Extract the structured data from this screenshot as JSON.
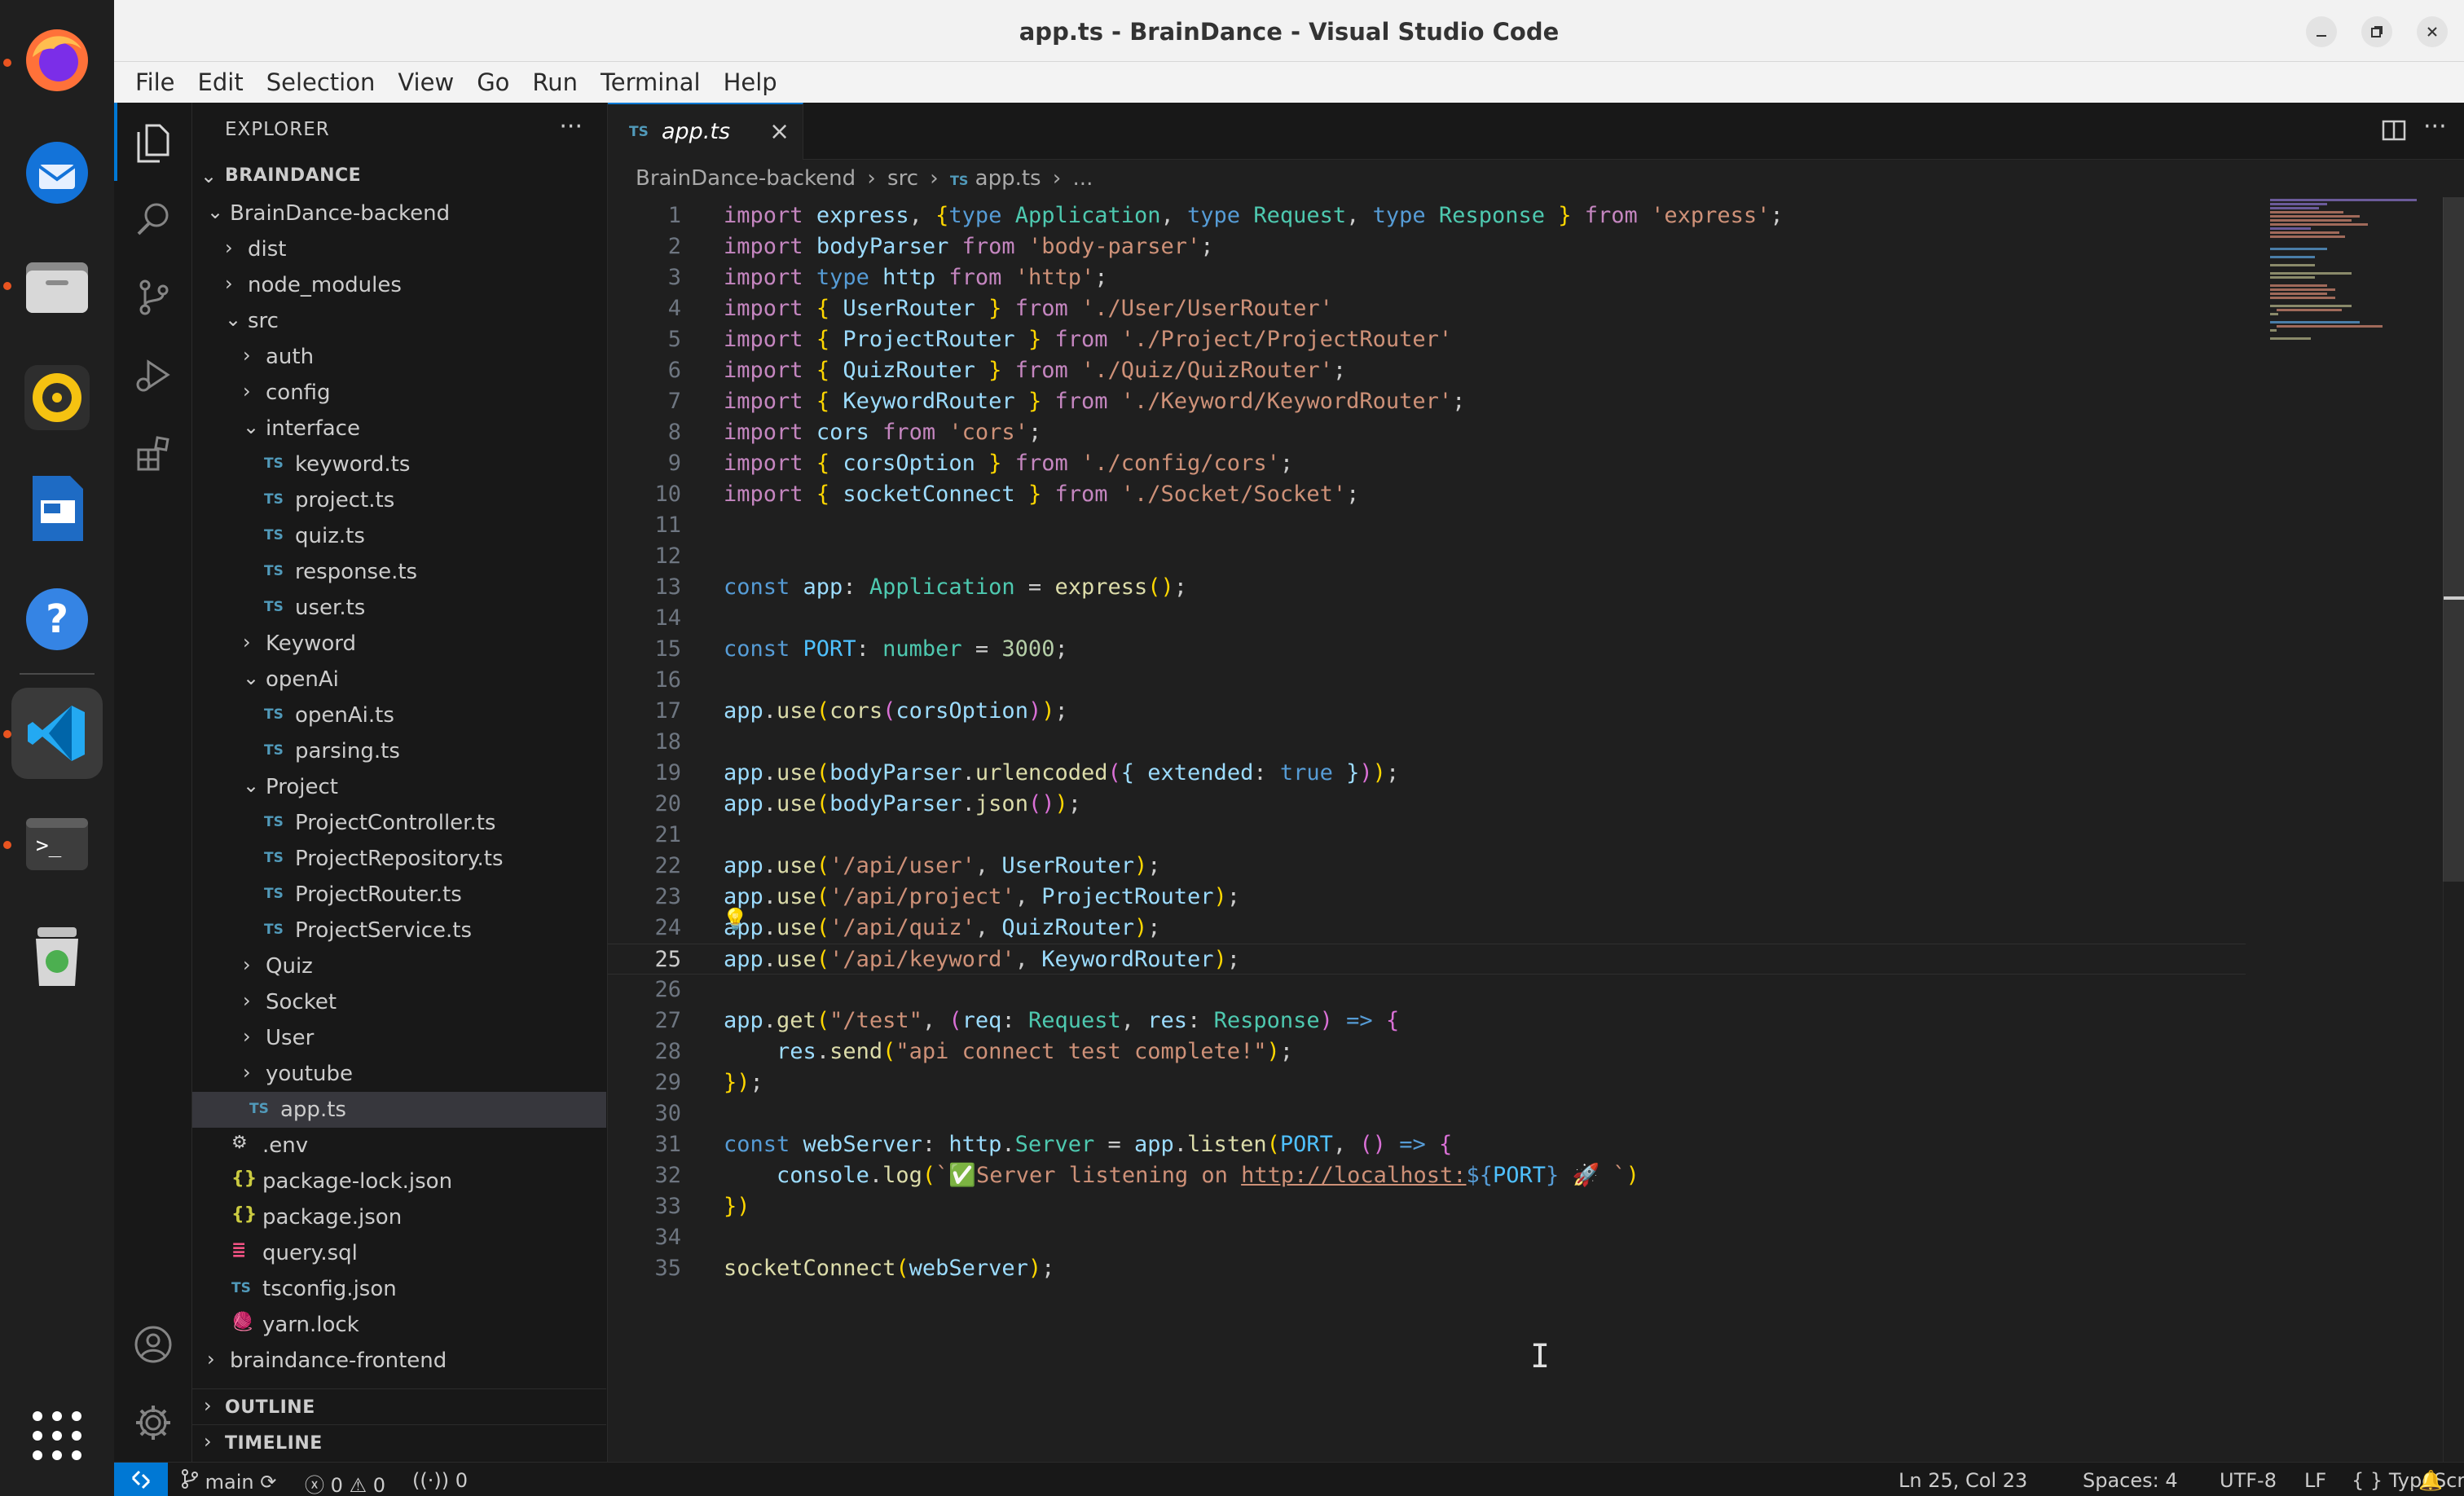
{
  "window": {
    "title": "app.ts - BrainDance - Visual Studio Code"
  },
  "menu": [
    "File",
    "Edit",
    "Selection",
    "View",
    "Go",
    "Run",
    "Terminal",
    "Help"
  ],
  "dock": [
    "firefox",
    "thunderbird",
    "files",
    "rhythmbox",
    "libreoffice-impress",
    "help",
    "vscode",
    "terminal",
    "trash",
    "show-applications"
  ],
  "explorer": {
    "title": "EXPLORER",
    "more": "···",
    "root": "BRAINDANCE",
    "tree": [
      {
        "label": "BrainDance-backend",
        "type": "folder-open",
        "depth": 1
      },
      {
        "label": "dist",
        "type": "folder",
        "depth": 2
      },
      {
        "label": "node_modules",
        "type": "folder",
        "depth": 2
      },
      {
        "label": "src",
        "type": "folder-open",
        "depth": 2
      },
      {
        "label": "auth",
        "type": "folder",
        "depth": 3
      },
      {
        "label": "config",
        "type": "folder",
        "depth": 3
      },
      {
        "label": "interface",
        "type": "folder-open",
        "depth": 3
      },
      {
        "label": "keyword.ts",
        "type": "ts",
        "depth": 4
      },
      {
        "label": "project.ts",
        "type": "ts",
        "depth": 4
      },
      {
        "label": "quiz.ts",
        "type": "ts",
        "depth": 4
      },
      {
        "label": "response.ts",
        "type": "ts",
        "depth": 4
      },
      {
        "label": "user.ts",
        "type": "ts",
        "depth": 4
      },
      {
        "label": "Keyword",
        "type": "folder",
        "depth": 3
      },
      {
        "label": "openAi",
        "type": "folder-open",
        "depth": 3
      },
      {
        "label": "openAi.ts",
        "type": "ts",
        "depth": 4
      },
      {
        "label": "parsing.ts",
        "type": "ts",
        "depth": 4
      },
      {
        "label": "Project",
        "type": "folder-open",
        "depth": 3
      },
      {
        "label": "ProjectController.ts",
        "type": "ts",
        "depth": 4
      },
      {
        "label": "ProjectRepository.ts",
        "type": "ts",
        "depth": 4
      },
      {
        "label": "ProjectRouter.ts",
        "type": "ts",
        "depth": 4
      },
      {
        "label": "ProjectService.ts",
        "type": "ts",
        "depth": 4
      },
      {
        "label": "Quiz",
        "type": "folder",
        "depth": 3
      },
      {
        "label": "Socket",
        "type": "folder",
        "depth": 3
      },
      {
        "label": "User",
        "type": "folder",
        "depth": 3
      },
      {
        "label": "youtube",
        "type": "folder",
        "depth": 3
      },
      {
        "label": "app.ts",
        "type": "ts",
        "depth": 3,
        "selected": true
      },
      {
        "label": ".env",
        "type": "env",
        "depth": 2
      },
      {
        "label": "package-lock.json",
        "type": "json",
        "depth": 2
      },
      {
        "label": "package.json",
        "type": "json",
        "depth": 2
      },
      {
        "label": "query.sql",
        "type": "sql",
        "depth": 2
      },
      {
        "label": "tsconfig.json",
        "type": "tsconfig",
        "depth": 2
      },
      {
        "label": "yarn.lock",
        "type": "yarn",
        "depth": 2
      },
      {
        "label": "braindance-frontend",
        "type": "folder",
        "depth": 1
      }
    ],
    "outline": "OUTLINE",
    "timeline": "TIMELINE"
  },
  "tab": {
    "icon_label": "TS",
    "name": "app.ts",
    "close": "×"
  },
  "breadcrumb": {
    "parts": [
      "BrainDance-backend",
      "src",
      "app.ts",
      "..."
    ],
    "icon_label": "TS",
    "separator": "›"
  },
  "editor": {
    "current_line": 25,
    "line_numbers": [
      "1",
      "2",
      "3",
      "4",
      "5",
      "6",
      "7",
      "8",
      "9",
      "10",
      "11",
      "12",
      "13",
      "14",
      "15",
      "16",
      "17",
      "18",
      "19",
      "20",
      "21",
      "22",
      "23",
      "24",
      "25",
      "26",
      "27",
      "28",
      "29",
      "30",
      "31",
      "32",
      "33",
      "34",
      "35"
    ],
    "lines": [
      "import express, {type Application, type Request, type Response } from 'express';",
      "import bodyParser from 'body-parser';",
      "import type http from 'http';",
      "import { UserRouter } from './User/UserRouter'",
      "import { ProjectRouter } from './Project/ProjectRouter'",
      "import { QuizRouter } from './Quiz/QuizRouter';",
      "import { KeywordRouter } from './Keyword/KeywordRouter';",
      "import cors from 'cors';",
      "import { corsOption } from './config/cors';",
      "import { socketConnect } from './Socket/Socket';",
      "",
      "",
      "const app: Application = express();",
      "",
      "const PORT: number = 3000;",
      "",
      "app.use(cors(corsOption));",
      "",
      "app.use(bodyParser.urlencoded({ extended: true }));",
      "app.use(bodyParser.json());",
      "",
      "app.use('/api/user', UserRouter);",
      "app.use('/api/project', ProjectRouter);",
      "app.use('/api/quiz', QuizRouter);",
      "app.use('/api/keyword', KeywordRouter);",
      "",
      "app.get(\"/test\", (req: Request, res: Response) => {",
      "    res.send(\"api connect test complete!\");",
      "});",
      "",
      "const webServer: http.Server = app.listen(PORT, () => {",
      "    console.log(`✅Server listening on http://localhost:${PORT} 🚀 `)",
      "})",
      "",
      "socketConnect(webServer);"
    ]
  },
  "status": {
    "branch": "main",
    "errors": "0",
    "warnings": "0",
    "ports": "0",
    "position": "Ln 25, Col 23",
    "spaces": "Spaces: 4",
    "encoding": "UTF-8",
    "eol": "LF",
    "language": "TypeScript"
  },
  "colors": {
    "accent": "#0078d4",
    "ts_icon": "#519aba",
    "ubuntu_orange": "#e95420"
  }
}
